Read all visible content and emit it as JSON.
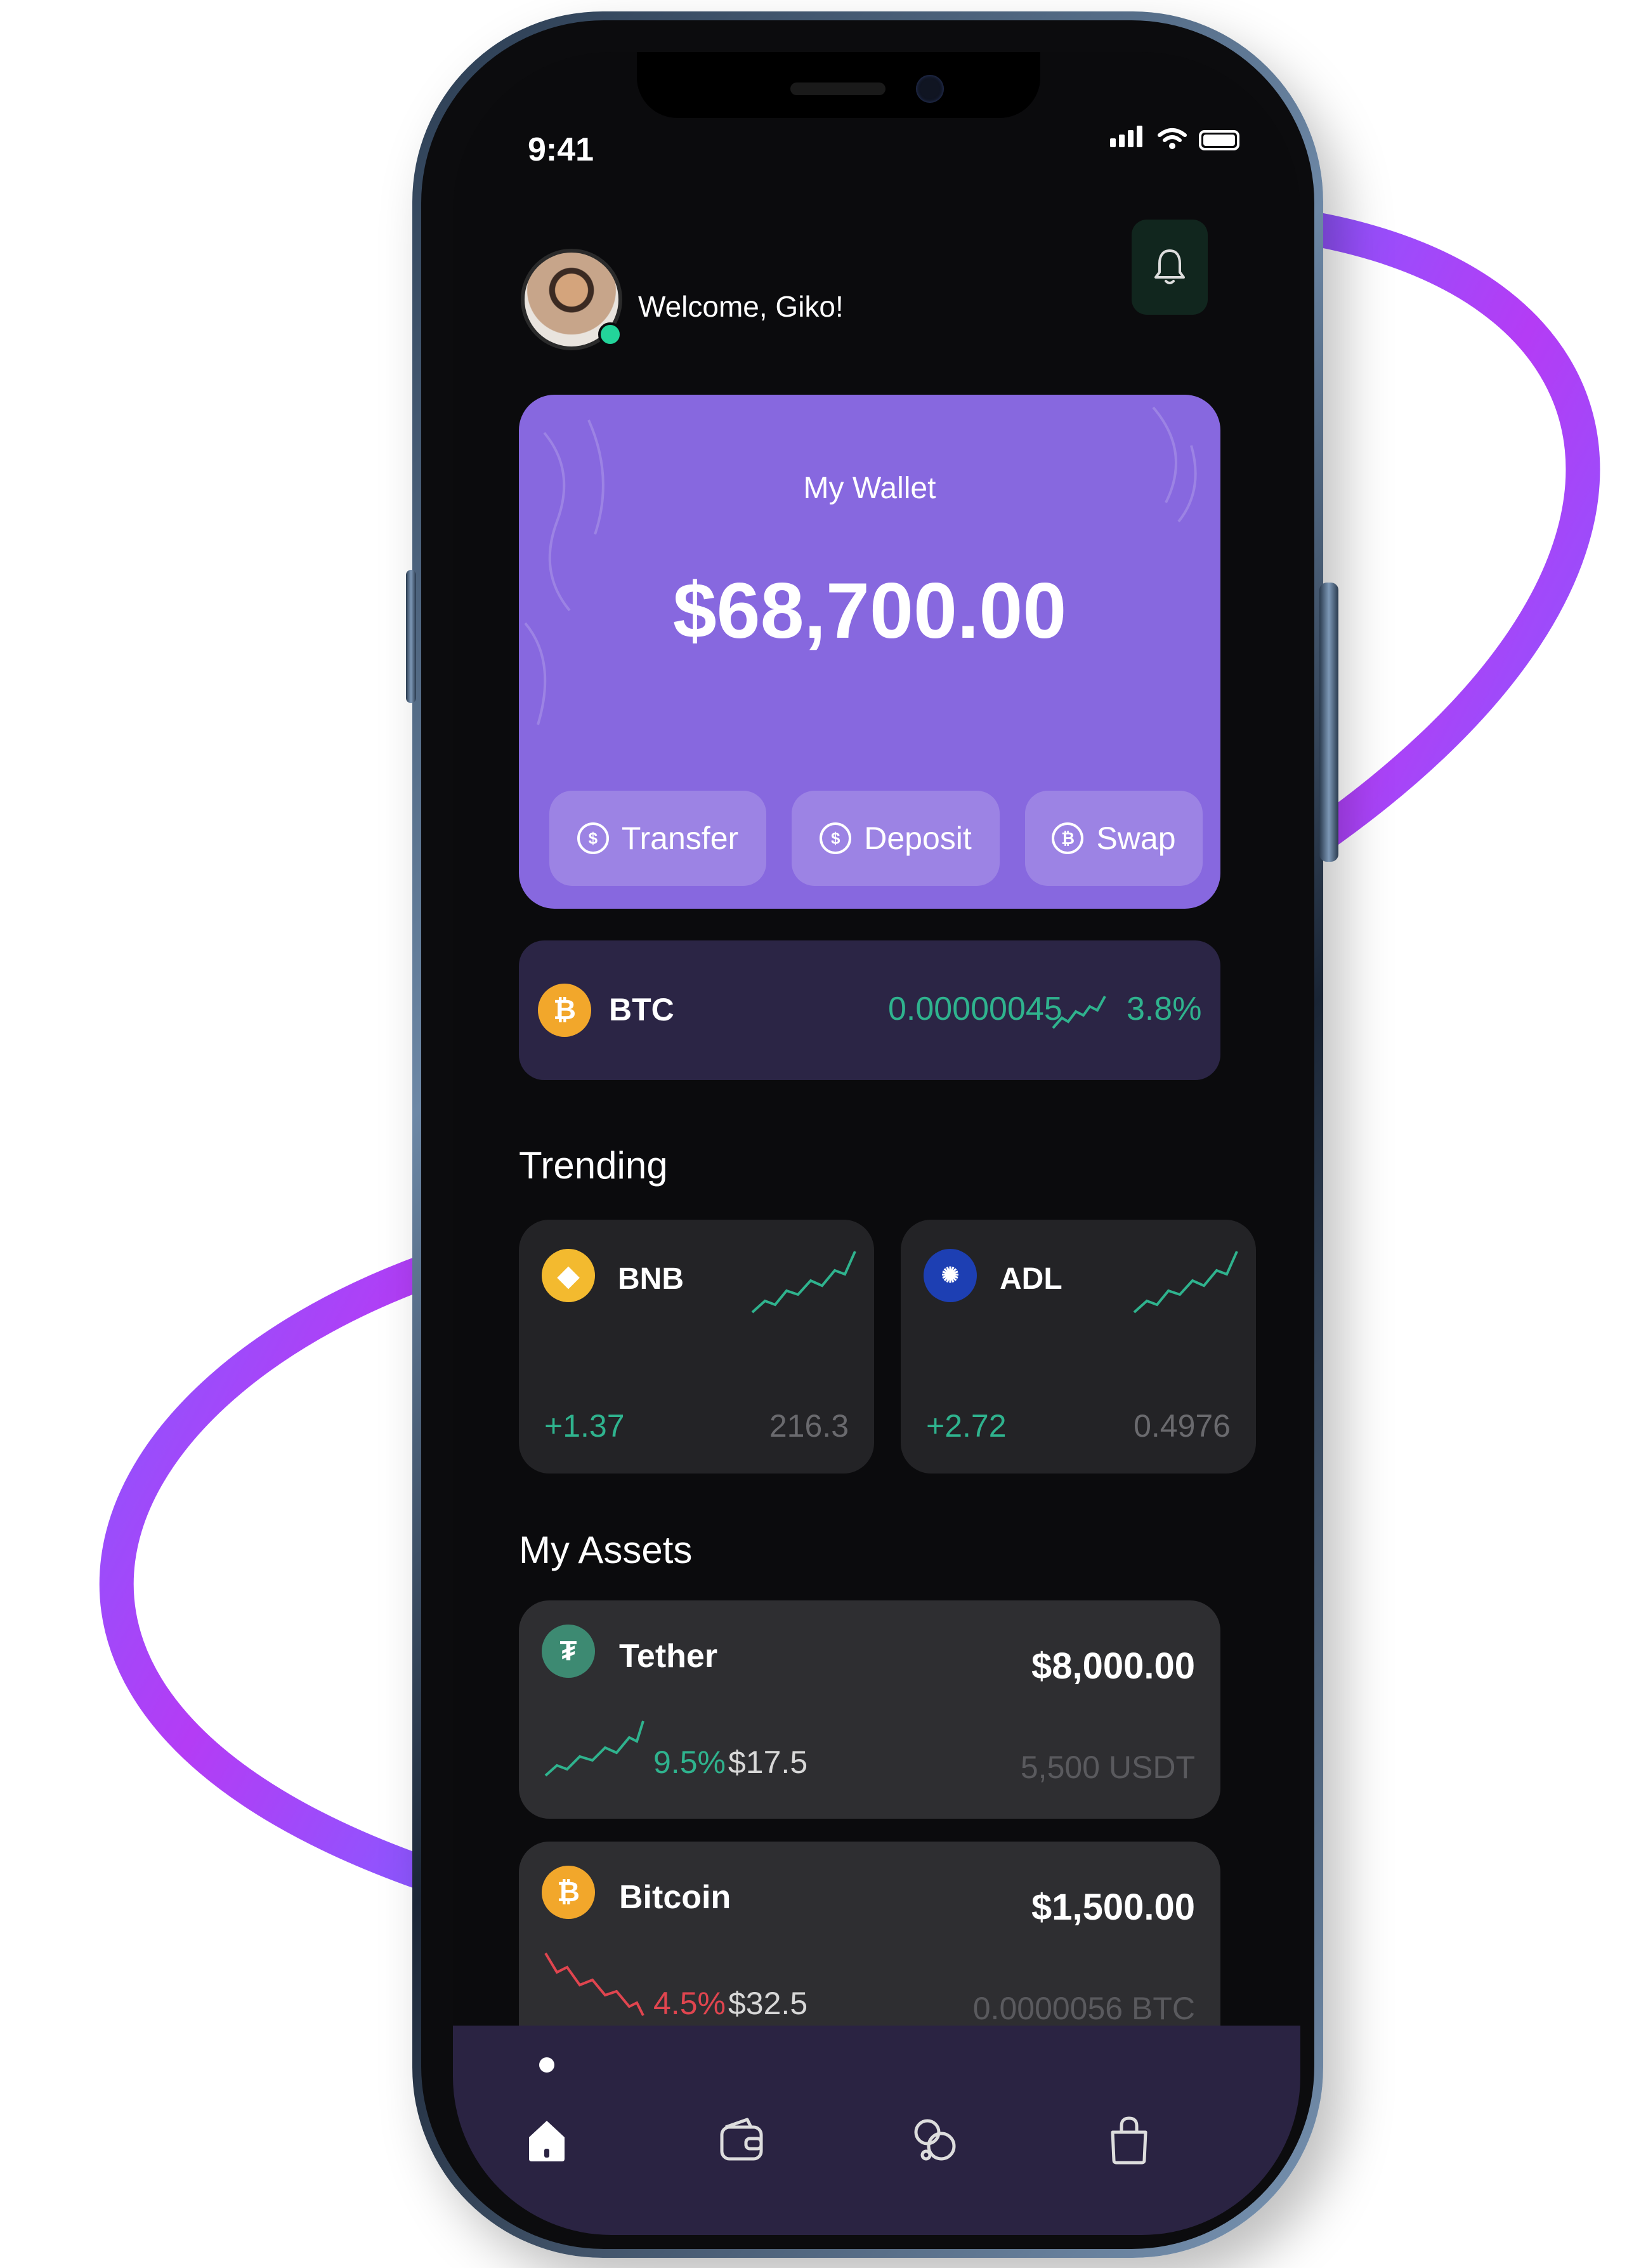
{
  "status_bar": {
    "time": "9:41"
  },
  "header": {
    "welcome": "Welcome, Giko!"
  },
  "wallet": {
    "title": "My Wallet",
    "balance": "$68,700.00",
    "actions": [
      {
        "label": "Transfer",
        "icon": "dollar-up-icon"
      },
      {
        "label": "Deposit",
        "icon": "dollar-down-icon"
      },
      {
        "label": "Swap",
        "icon": "swap-coins-icon"
      }
    ]
  },
  "btc_strip": {
    "symbol": "BTC",
    "amount": "0.00000045",
    "change": "3.8%"
  },
  "trending": {
    "title": "Trending",
    "items": [
      {
        "name": "BNB",
        "change": "+1.37",
        "price": "216.3",
        "icon": "bnb-icon"
      },
      {
        "name": "ADL",
        "change": "+2.72",
        "price": "0.4976",
        "icon": "ada-icon"
      }
    ]
  },
  "assets": {
    "title": "My Assets",
    "items": [
      {
        "name": "Tether",
        "value": "$8,000.00",
        "change": "9.5%",
        "change_usd": "$17.5",
        "holding": "5,500 USDT",
        "trend": "up"
      },
      {
        "name": "Bitcoin",
        "value": "$1,500.00",
        "change": "4.5%",
        "change_usd": "$32.5",
        "holding": "0.0000056 BTC",
        "trend": "down"
      }
    ]
  },
  "nav": {
    "items": [
      "home-icon",
      "wallet-icon",
      "coins-icon",
      "bag-icon"
    ],
    "active": "home-icon"
  },
  "colors": {
    "accent": "#8768df",
    "positive": "#2fb38e",
    "negative": "#e0454f",
    "ring": "#8a4dff",
    "btc": "#f2a72b",
    "bnb": "#f3ba2f",
    "ada": "#1d3fb3",
    "usdt": "#3d8a72"
  }
}
